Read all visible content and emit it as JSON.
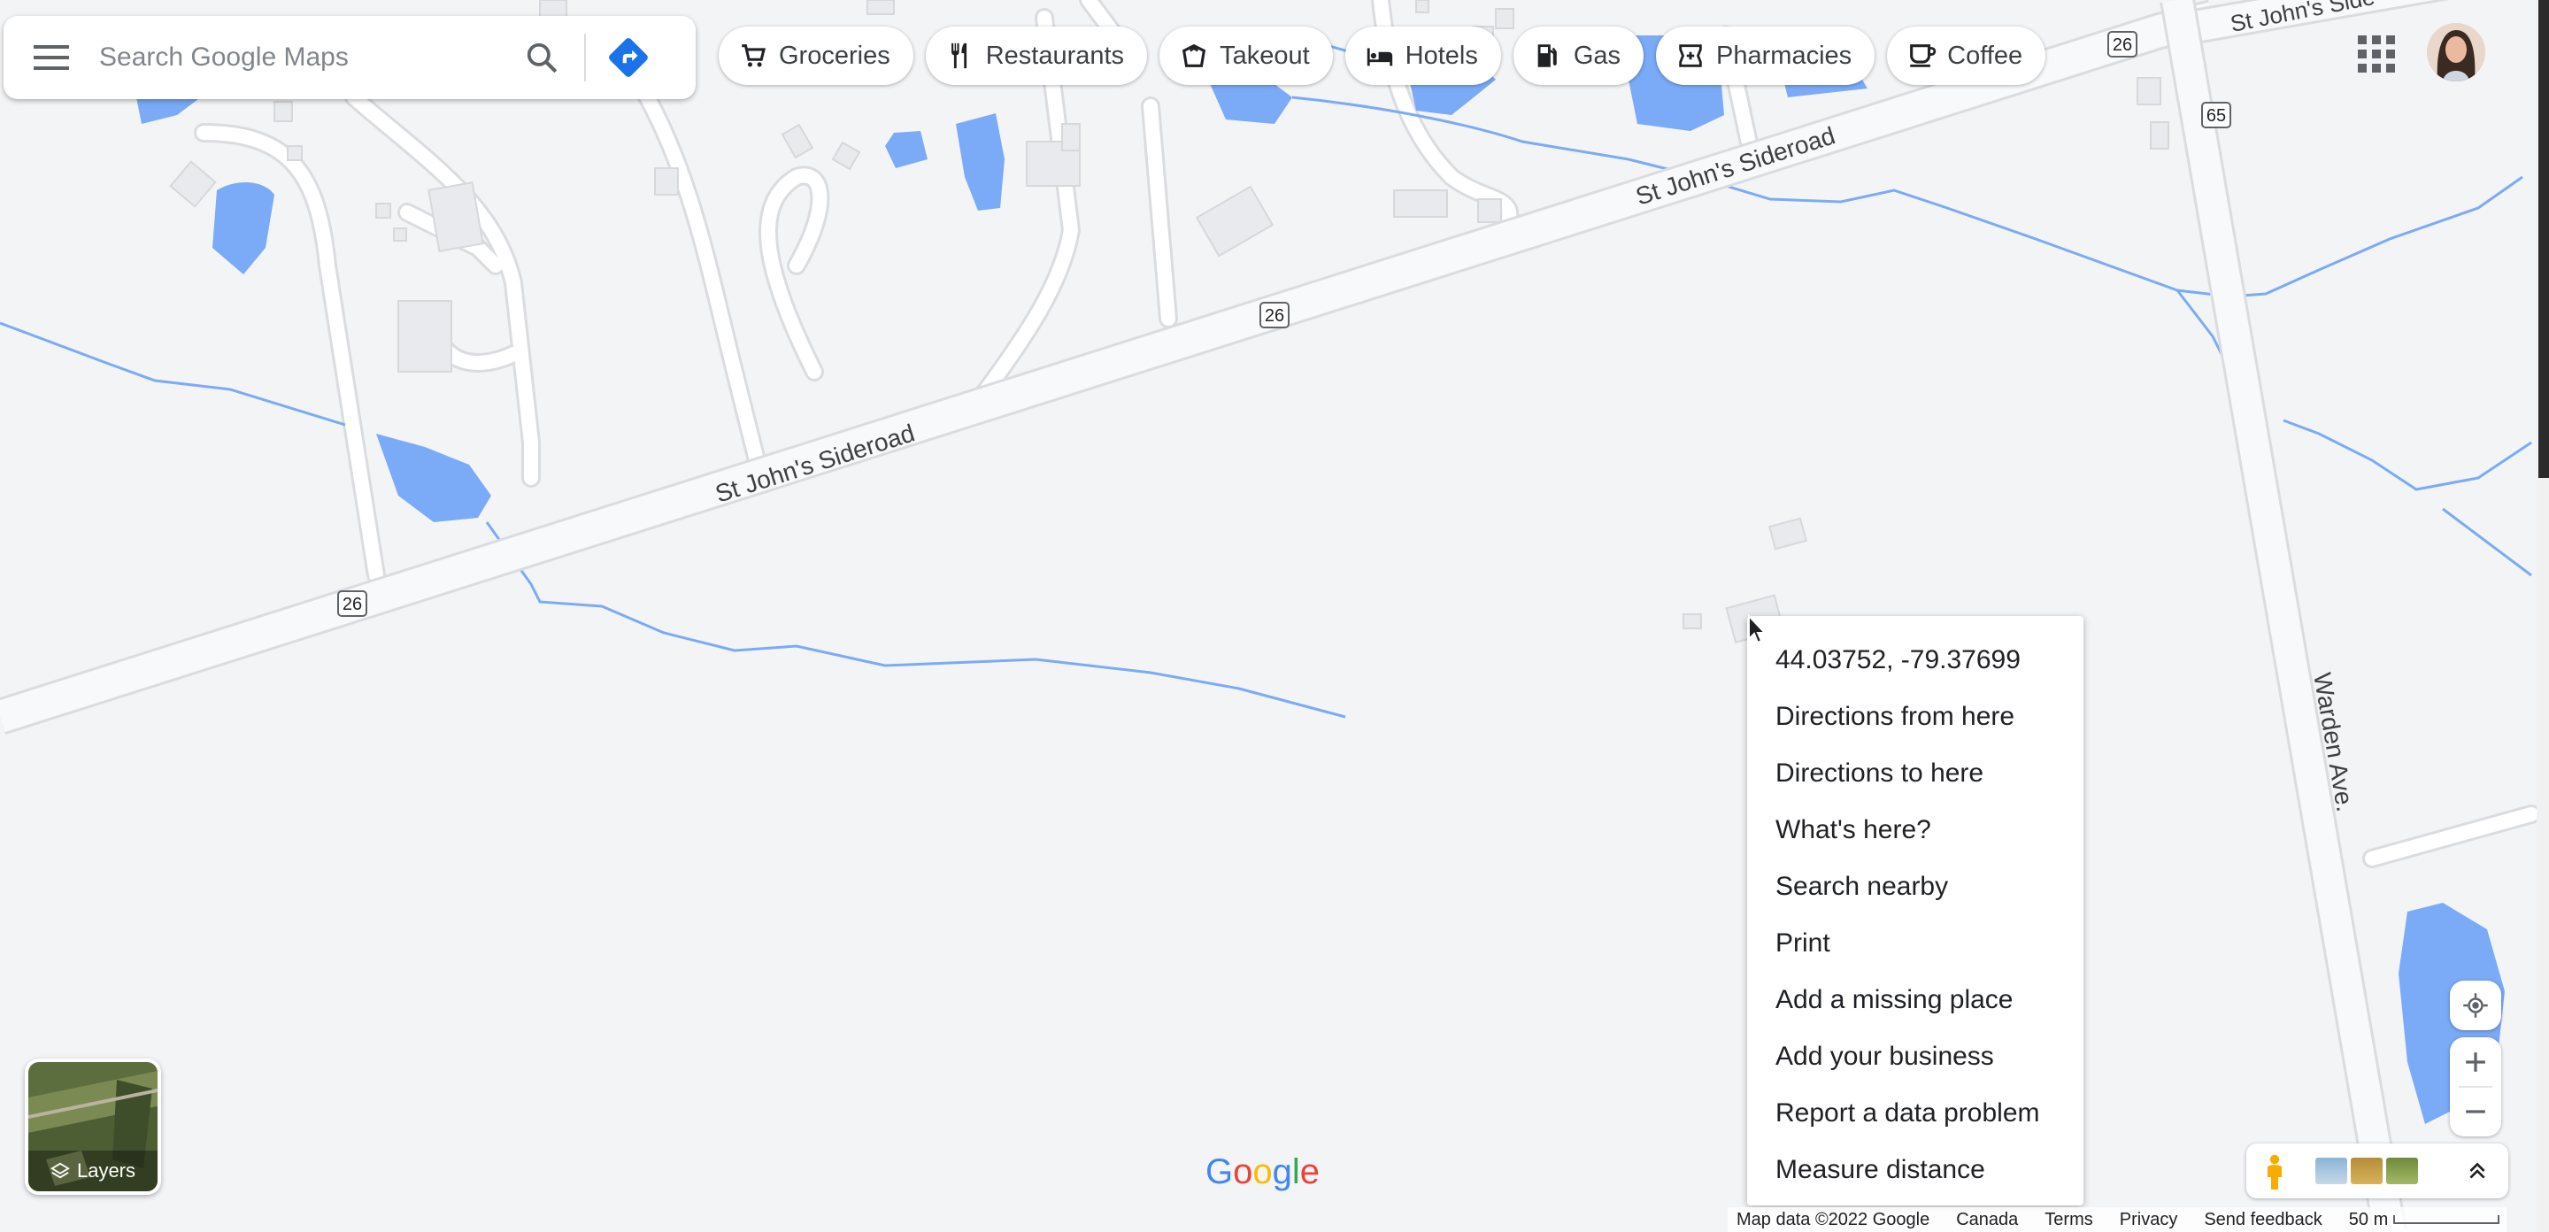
{
  "search": {
    "placeholder": "Search Google Maps"
  },
  "chips": [
    {
      "label": "Groceries",
      "icon": "cart-icon"
    },
    {
      "label": "Restaurants",
      "icon": "fork-knife-icon"
    },
    {
      "label": "Takeout",
      "icon": "takeout-box-icon"
    },
    {
      "label": "Hotels",
      "icon": "bed-icon"
    },
    {
      "label": "Gas",
      "icon": "gas-pump-icon"
    },
    {
      "label": "Pharmacies",
      "icon": "pharmacy-icon"
    },
    {
      "label": "Coffee",
      "icon": "coffee-cup-icon"
    }
  ],
  "map": {
    "road_labels": [
      "St John's Sideroad",
      "St John's Sideroad",
      "Warden Ave.",
      "St John's Side"
    ],
    "route_shields": [
      "26",
      "26",
      "26",
      "65"
    ],
    "colors": {
      "background": "#f3f4f6",
      "water": "#7baaf7",
      "road": "#ffffff",
      "road_edge": "#dadce0",
      "building": "#e8eaed"
    }
  },
  "context_menu": {
    "coordinates": "44.03752, -79.37699",
    "items": [
      "Directions from here",
      "Directions to here",
      "What's here?",
      "Search nearby",
      "Print",
      "Add a missing place",
      "Add your business",
      "Report a data problem",
      "Measure distance"
    ]
  },
  "layers": {
    "label": "Layers"
  },
  "footer": {
    "map_data": "Map data ©2022 Google",
    "country": "Canada",
    "terms": "Terms",
    "privacy": "Privacy",
    "feedback": "Send feedback",
    "scale": "50 m"
  },
  "logo": "Google"
}
